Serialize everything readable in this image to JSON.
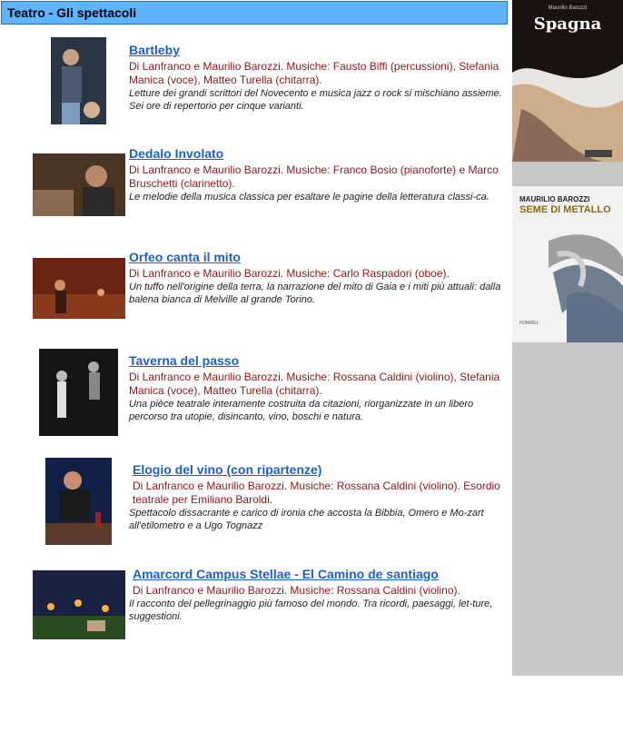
{
  "header": {
    "title": "Teatro - Gli spettacoli"
  },
  "shows": [
    {
      "title": "Bartleby",
      "credits": "Di Lanfranco e Maurilio Barozzi. Musiche: Fausto Biffi (percussioni), Stefania Manica (voce), Matteo Turella (chitarra).",
      "description": "Letture dei grandi scrittori del Novecento e musica jazz o rock si mischiano assieme. Sei ore di repertorio per cinque varianti."
    },
    {
      "title": "Dedalo Involato",
      "credits": "Di Lanfranco e Maurilio Barozzi. Musiche: Franco Bosio (pianoforte) e Marco Bruschetti (clarinetto).",
      "description": "Le melodie della musica classica per esaltare le pagine della letteratura classi-ca."
    },
    {
      "title": "Orfeo canta il mito",
      "credits": "Di Lanfranco e Maurilio Barozzi. Musiche: Carlo Raspadori (oboe).",
      "description": "Un tuffo nell'origine della terra, la narrazione del mito di Gaia e i miti più attuali: dalla balena bianca di Melville al grande Torino."
    },
    {
      "title": "Taverna del passo",
      "credits": "Di Lanfranco e Maurilio Barozzi. Musiche: Rossana Caldini (violino), Stefania Manica (voce), Matteo Turella (chitarra).",
      "description": "Una pièce teatrale interamente costruita da citazioni, riorganizzate in un libero percorso tra utopie, disincanto, vino, boschi e natura."
    },
    {
      "title": "Elogio del vino (con ripartenze)",
      "credits": "Di Lanfranco e Maurilio Barozzi. Musiche: Rossana Caldini (violino). Esordio teatrale per Emiliano Baroldi.",
      "description": "Spettacolo dissacrante e carico di ironia che accosta la Bibbia,  Omero e Mo-zart all'etilometro e a Ugo Tognazz"
    },
    {
      "title": "Amarcord Campus Stellae - El Camino de santiago",
      "credits": "Di Lanfranco e Maurilio Barozzi. Musiche: Rossana Caldini (violino).",
      "description": "Il racconto del pellegrinaggio più famoso del mondo. Tra ricordi, paesaggi, let-ture, suggestioni."
    }
  ],
  "sidebar": {
    "book1": {
      "title": "Spagna",
      "subtitle": "Maurilio Barozzi"
    },
    "book2": {
      "author": "MAURILIO BAROZZI",
      "title": "SEME DI METALLO",
      "publisher": "FOMMEL"
    }
  }
}
